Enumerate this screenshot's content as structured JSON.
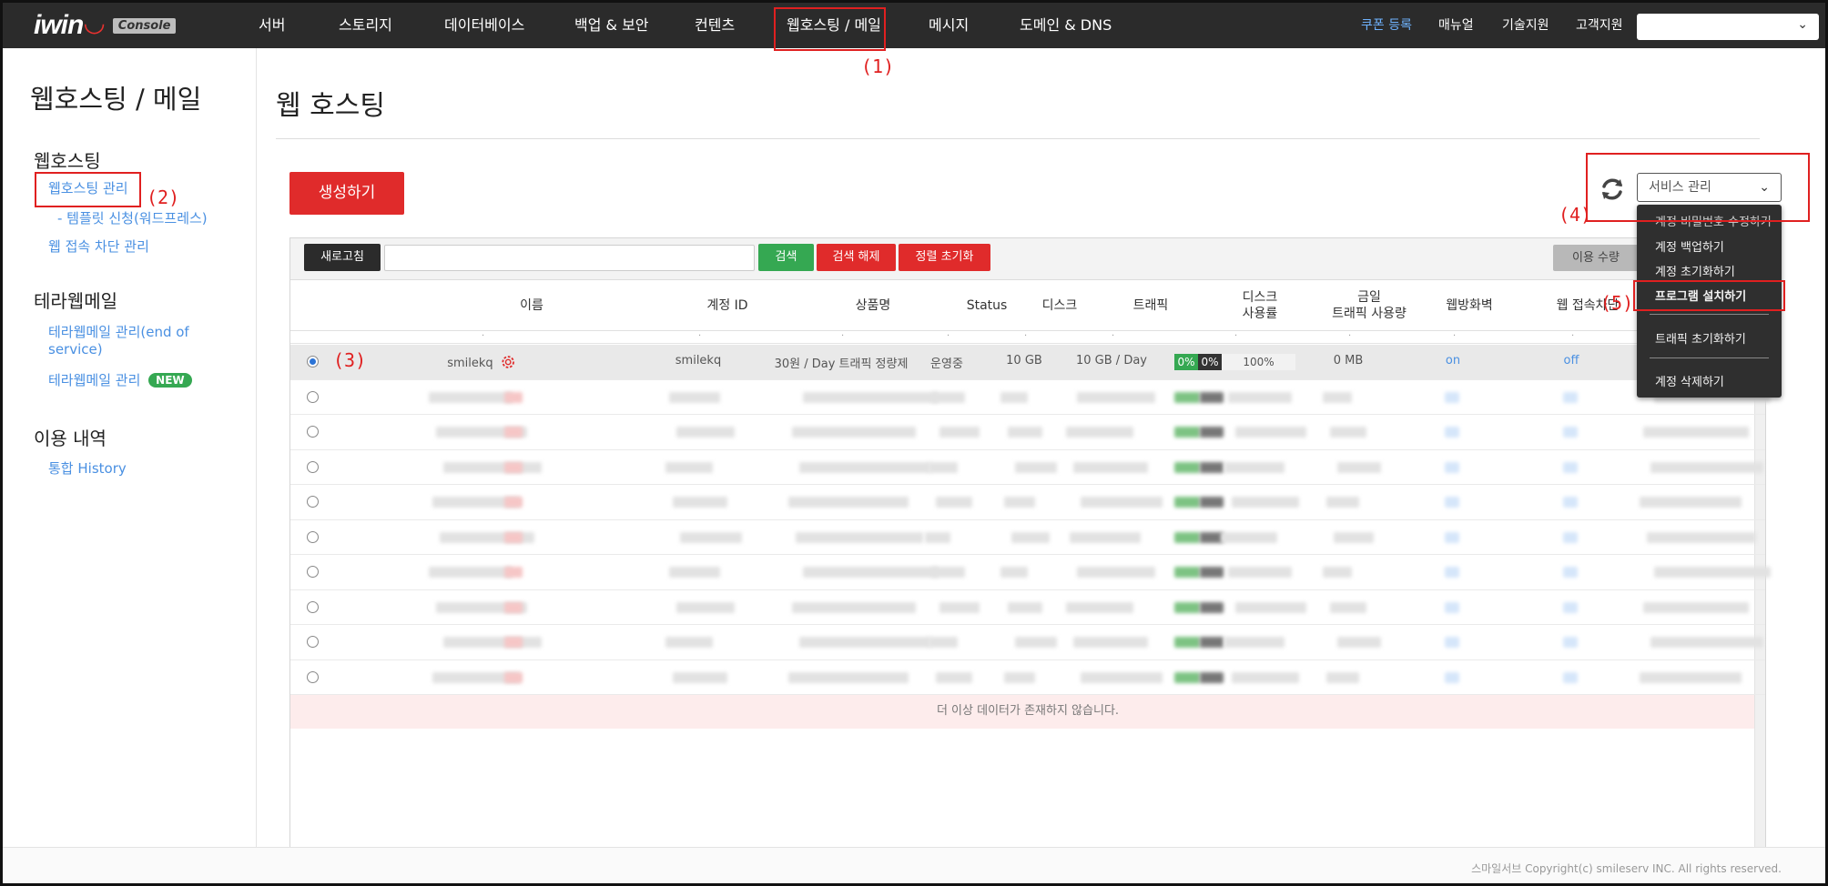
{
  "brand": {
    "name": "iwin",
    "badge": "Console"
  },
  "topnav": {
    "items": [
      "서버",
      "스토리지",
      "데이터베이스",
      "백업 & 보안",
      "컨텐츠",
      "웹호스팅 / 메일",
      "메시지",
      "도메인 & DNS"
    ],
    "right": [
      "쿠폰 등록",
      "매뉴얼",
      "기술지원",
      "고객지원"
    ],
    "select_value": ""
  },
  "sidebar": {
    "title": "웹호스팅 / 메일",
    "sections": [
      {
        "title": "웹호스팅",
        "links": [
          "웹호스팅 관리",
          "- 템플릿 신청(워드프레스)",
          "웹 접속 차단 관리"
        ]
      },
      {
        "title": "테라웹메일",
        "links": [
          "테라웹메일 관리(end of",
          "service)",
          "테라웹메일 관리"
        ],
        "badge": "NEW"
      },
      {
        "title": "이용 내역",
        "links": [
          "통합 History"
        ]
      }
    ]
  },
  "main": {
    "heading": "웹 호스팅",
    "create_label": "생성하기",
    "service_select": "서비스 관리",
    "toolbar": {
      "refresh": "새로고침",
      "search_value": "",
      "search": "검색",
      "search_clear": "검색 해제",
      "sort_reset": "정렬 초기화",
      "usage": "이용 수량"
    },
    "columns": [
      "이름",
      "계정 ID",
      "상품명",
      "Status",
      "디스크",
      "트래픽",
      "디스크\n사용률",
      "금일\n트래픽 사용량",
      "웹방화벽",
      "웹 접속차단"
    ],
    "first_row": {
      "name": "smilekq",
      "account_id": "smilekq",
      "product": "30원 / Day 트래픽 정량제",
      "status": "운영중",
      "disk": "10 GB",
      "traffic": "10 GB / Day",
      "disk_usage": [
        "0%",
        "0%",
        "100%"
      ],
      "today_traffic": "0 MB",
      "waf": "on",
      "block": "off"
    },
    "no_more": "더 이상 데이터가 존재하지 않습니다."
  },
  "dropdown": {
    "items": [
      "계정 비밀번호 수정하기",
      "계정 백업하기",
      "계정 초기화하기",
      "프로그램 설치하기",
      "트래픽 초기화하기",
      "계정 삭제하기"
    ]
  },
  "annotations": [
    "(1)",
    "(2)",
    "(3)",
    "(4)",
    "(5)"
  ],
  "footer": "스마일서브 Copyright(c) smileserv INC. All rights reserved.",
  "colors": {
    "accent_red": "#e02b2b",
    "link_blue": "#4a90e2",
    "search_green": "#35a852",
    "nav_dark": "#2b2b2b"
  }
}
